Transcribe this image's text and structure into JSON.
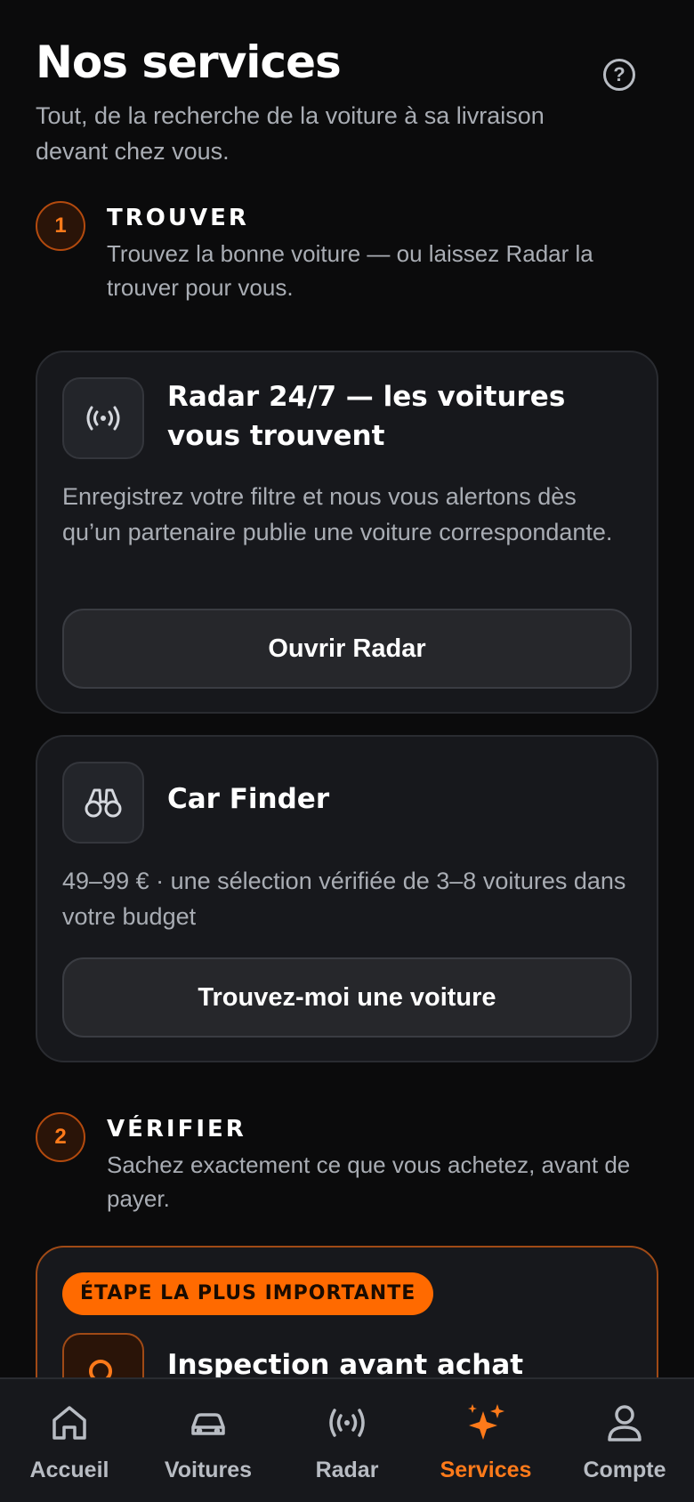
{
  "header": {
    "title": "Nos services",
    "subtitle": "Tout, de la recherche de la voiture à sa livraison devant chez vous.",
    "help_icon": "help-circle-icon"
  },
  "steps": [
    {
      "number": "1",
      "title": "TROUVER",
      "description": "Trouvez la bonne voiture — ou laissez Radar la trouver pour vous."
    },
    {
      "number": "2",
      "title": "VÉRIFIER",
      "description": "Sachez exactement ce que vous achetez, avant de payer."
    }
  ],
  "cards": {
    "radar": {
      "icon": "radar-broadcast-icon",
      "title": "Radar 24/7 — les voitures vous trouvent",
      "description": "Enregistrez votre filtre et nous vous alertons dès qu’un partenaire publie une voiture correspondante.",
      "button": "Ouvrir Radar"
    },
    "car_finder": {
      "icon": "binoculars-icon",
      "title": "Car Finder",
      "description": "49–99 € · une sélection vérifiée de 3–8 voitures dans votre budget",
      "button": "Trouvez-moi une voiture"
    },
    "inspection": {
      "badge": "ÉTAPE LA PLUS IMPORTANTE",
      "icon": "search-icon",
      "title": "Inspection avant achat"
    }
  },
  "tabbar": {
    "accent": "#ff7a1a",
    "items": [
      {
        "label": "Accueil",
        "icon": "home-icon"
      },
      {
        "label": "Voitures",
        "icon": "car-icon"
      },
      {
        "label": "Radar",
        "icon": "radar-icon"
      },
      {
        "label": "Services",
        "icon": "sparkles-icon",
        "active": true
      },
      {
        "label": "Compte",
        "icon": "user-icon"
      }
    ]
  }
}
